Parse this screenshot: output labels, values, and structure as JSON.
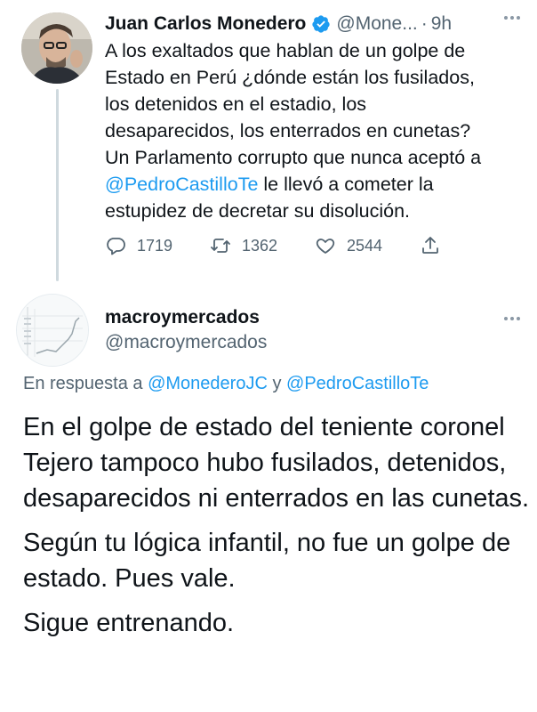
{
  "tweet1": {
    "author_name": "Juan Carlos Monedero",
    "handle": "@Mone...",
    "separator": "·",
    "time": "9h",
    "text_lines": [
      "A los exaltados que hablan de un golpe de",
      "Estado en Perú ¿dónde están los fusilados,",
      "los detenidos en el estadio, los",
      "desaparecidos, los enterrados en cunetas?",
      "Un Parlamento corrupto que nunca aceptó a"
    ],
    "mention": "@PedroCastilloTe",
    "text_after_mention": " le llevó a cometer la",
    "text_last_line": "estupidez de decretar su disolución.",
    "replies": "1719",
    "retweets": "1362",
    "likes": "2544",
    "icons": [
      "verified-icon",
      "more-icon",
      "reply-icon",
      "retweet-icon",
      "like-icon",
      "share-icon"
    ],
    "colors": {
      "accent": "#1d9bf0",
      "secondary_text": "#536471"
    }
  },
  "tweet2": {
    "author_name": "macroymercados",
    "handle": "@macroymercados",
    "reply_prefix": "En respuesta a ",
    "reply_to_1": "@MonederoJC",
    "reply_conjunction": " y ",
    "reply_to_2": "@PedroCastilloTe",
    "paragraphs": [
      "En el golpe de estado del teniente coronel Tejero tampoco hubo fusilados, detenidos, desaparecidos ni enterrados en las cunetas.",
      "Según tu lógica infantil, no fue un golpe de estado. Pues vale.",
      "Sigue entrenando."
    ],
    "icons": [
      "more-icon"
    ]
  }
}
